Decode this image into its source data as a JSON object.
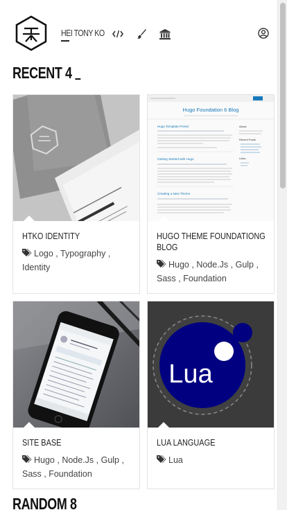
{
  "header": {
    "brand": "HEI TONY KO",
    "logo_icon": "hex-monogram-logo",
    "nav_icons": [
      "code-icon",
      "paint-brush-icon",
      "bank-icon"
    ],
    "user_icon": "user-circle-icon"
  },
  "recent": {
    "title": "RECENT 4",
    "cards": [
      {
        "title": "HTKO IDENTITY",
        "tags": [
          "Logo",
          "Typography",
          "Identity"
        ],
        "thumb": "business-card-photo"
      },
      {
        "title": "HUGO THEME FOUNDATIONG BLOG",
        "tags": [
          "Hugo",
          "Node.Js",
          "Gulp",
          "Sass",
          "Foundation"
        ],
        "thumb": "blog-screenshot",
        "thumb_text": {
          "heading": "Hugo Foundation 6 Blog",
          "post1": "Hugo Template Primer",
          "post2": "Getting Started with Hugo",
          "post3": "Creating a New Theme",
          "sidebar1": "About",
          "sidebar2": "Recent Posts",
          "sidebar3": "Links"
        }
      },
      {
        "title": "SITE BASE",
        "tags": [
          "Hugo",
          "Node.Js",
          "Gulp",
          "Sass",
          "Foundation"
        ],
        "thumb": "phone-photo"
      },
      {
        "title": "LUA LANGUAGE",
        "tags": [
          "Lua"
        ],
        "thumb": "lua-logo",
        "thumb_text": {
          "logo": "Lua"
        }
      }
    ]
  },
  "random": {
    "title": "RANDOM 8"
  },
  "colors": {
    "lua_blue": "#000080",
    "thumb_dark": "#3a3a3a"
  }
}
